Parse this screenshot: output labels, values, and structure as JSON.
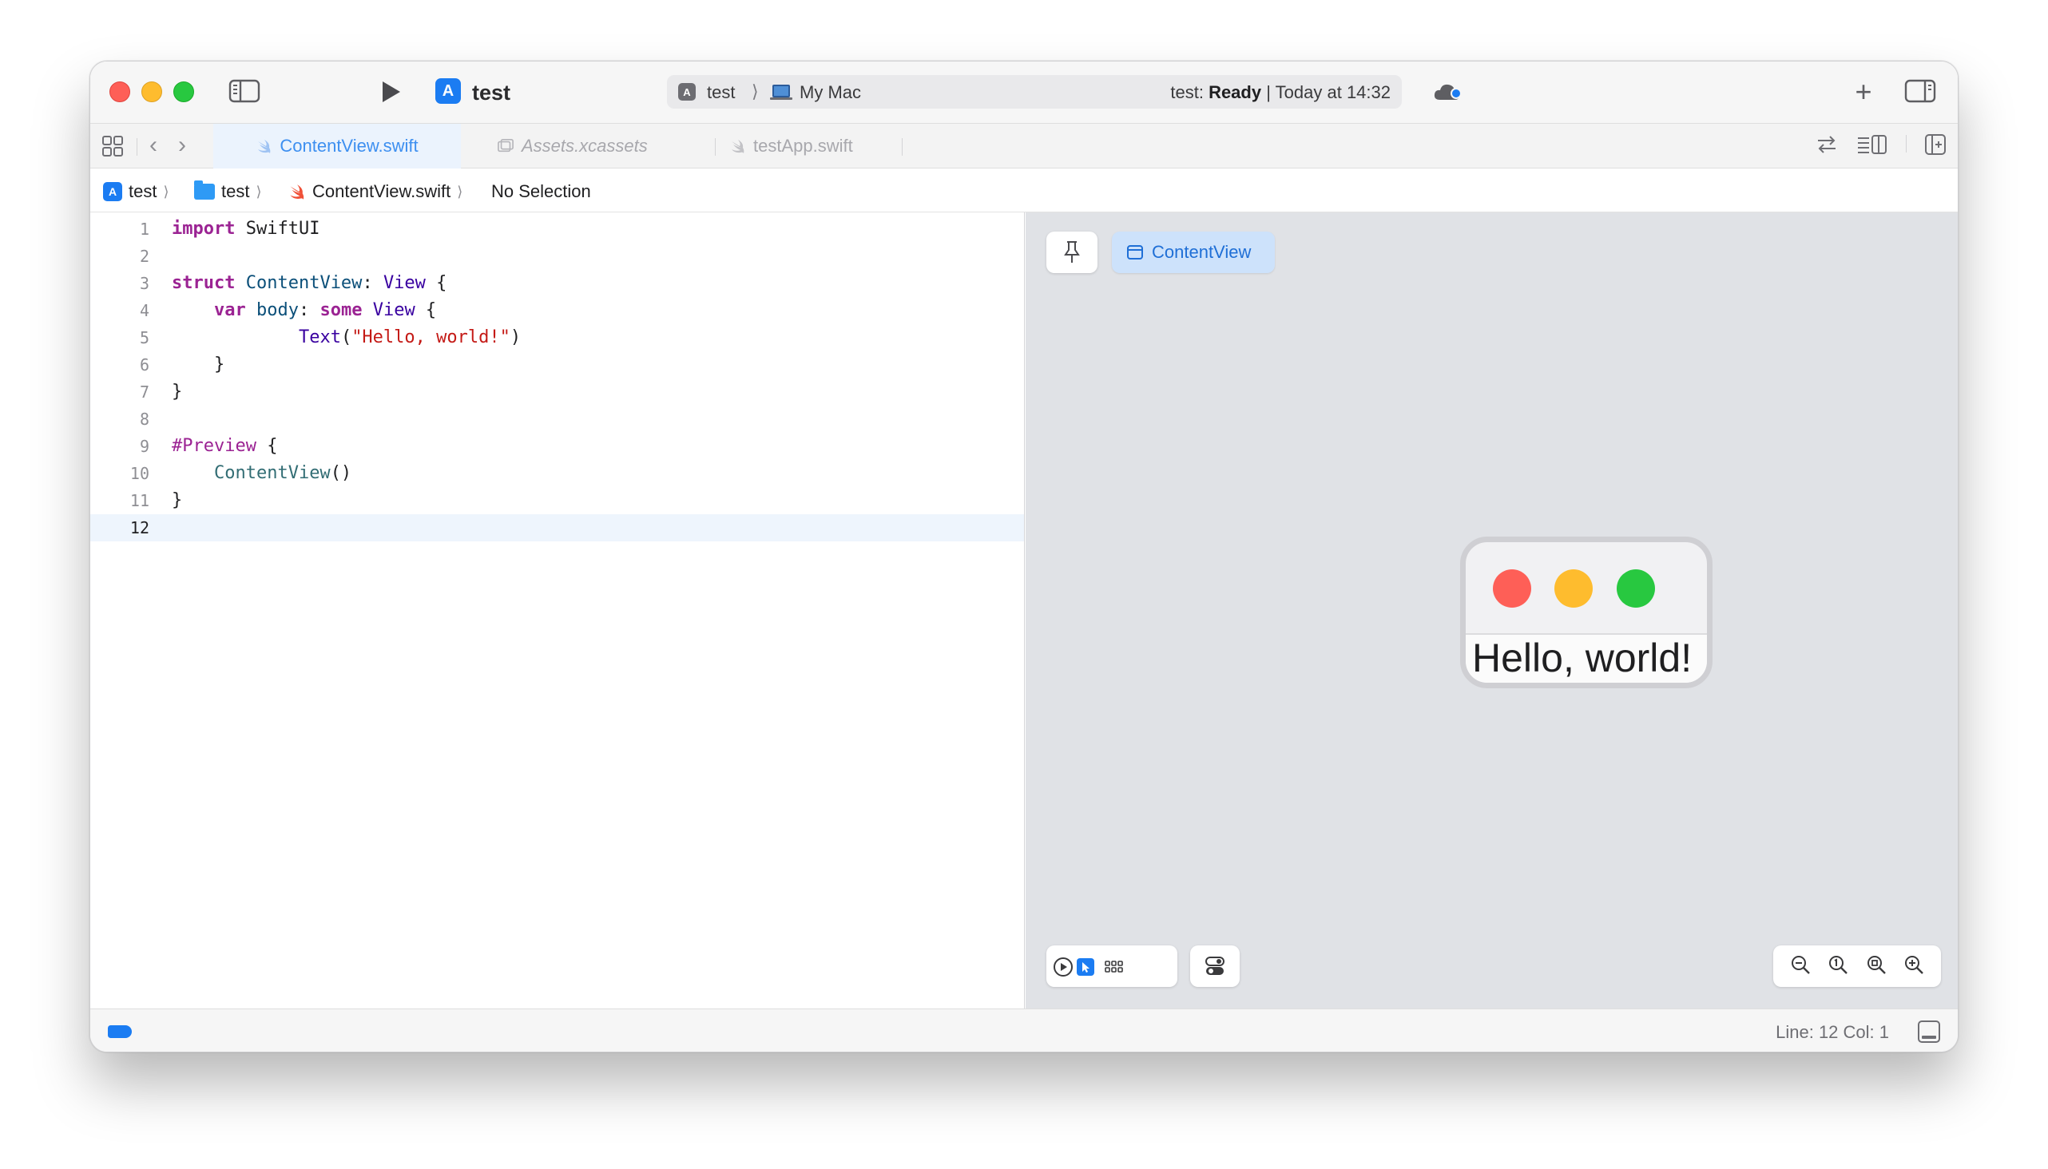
{
  "toolbar": {
    "project_name": "test",
    "scheme": "test",
    "destination": "My Mac",
    "status_prefix": "test:",
    "status_state": "Ready",
    "status_suffix": "| Today at 14:32"
  },
  "tabs": [
    {
      "label": "ContentView.swift",
      "active": true
    },
    {
      "label": "Assets.xcassets",
      "active": false
    },
    {
      "label": "testApp.swift",
      "active": false
    }
  ],
  "breadcrumb": {
    "project": "test",
    "folder": "test",
    "file": "ContentView.swift",
    "symbol": "No Selection"
  },
  "editor": {
    "current_line": 12,
    "lines": [
      {
        "n": "1"
      },
      {
        "n": "2"
      },
      {
        "n": "3"
      },
      {
        "n": "4"
      },
      {
        "n": "5"
      },
      {
        "n": "6"
      },
      {
        "n": "7"
      },
      {
        "n": "8"
      },
      {
        "n": "9"
      },
      {
        "n": "10"
      },
      {
        "n": "11"
      },
      {
        "n": "12"
      }
    ],
    "tokens": {
      "l1_kw": "import",
      "l1_rest": " SwiftUI",
      "l3_kw": "struct",
      "l3_name": " ContentView",
      "l3_colon": ": ",
      "l3_type": "View",
      "l3_brace": " {",
      "l4_indent": "    ",
      "l4_kw": "var",
      "l4_name": " body",
      "l4_colon": ": ",
      "l4_kw2": "some",
      "l4_sp": " ",
      "l4_type": "View",
      "l4_brace": " {",
      "l5_indent": "            ",
      "l5_fn": "Text",
      "l5_open": "(",
      "l5_str": "\"Hello, world!\"",
      "l5_close": ")",
      "l6": "    }",
      "l7": "}",
      "l9_kw": "#Preview",
      "l9_brace": " {",
      "l10_indent": "    ",
      "l10_fn": "ContentView",
      "l10_paren": "()",
      "l11": "}"
    }
  },
  "canvas": {
    "preview_tab_label": "ContentView",
    "preview_text": "Hello, world!"
  },
  "statusbar": {
    "cursor": "Line: 12  Col: 1"
  },
  "colors": {
    "accent": "#1b7cf2",
    "keyword": "#9b2393",
    "string": "#c41a16",
    "type": "#3900a0"
  }
}
